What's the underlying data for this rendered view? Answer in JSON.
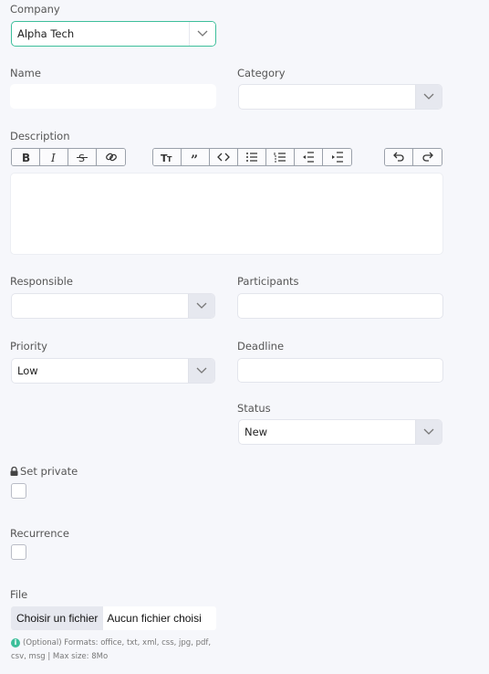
{
  "company": {
    "label": "Company",
    "value": "Alpha Tech"
  },
  "name": {
    "label": "Name",
    "value": ""
  },
  "category": {
    "label": "Category",
    "value": ""
  },
  "description": {
    "label": "Description",
    "value": ""
  },
  "toolbar": {
    "group1": [
      "bold-icon",
      "italic-icon",
      "strikethrough-icon",
      "link-icon"
    ],
    "group2": [
      "text-size-icon",
      "quote-icon",
      "code-icon",
      "bullet-list-icon",
      "numbered-list-icon",
      "outdent-icon",
      "indent-icon"
    ],
    "group3": [
      "undo-icon",
      "redo-icon"
    ]
  },
  "responsible": {
    "label": "Responsible",
    "value": ""
  },
  "participants": {
    "label": "Participants",
    "value": ""
  },
  "priority": {
    "label": "Priority",
    "value": "Low"
  },
  "deadline": {
    "label": "Deadline",
    "value": ""
  },
  "status": {
    "label": "Status",
    "value": "New"
  },
  "set_private": {
    "label": "Set private",
    "checked": false
  },
  "recurrence": {
    "label": "Recurrence",
    "checked": false
  },
  "file": {
    "label": "File",
    "button_label": "Choisir un fichier",
    "no_file_label": "Aucun fichier choisi",
    "help_line1": "(Optional) Formats: office, txt, xml, css, jpg, pdf,",
    "help_line2": "csv, msg | Max size: 8Mo"
  },
  "colors": {
    "accent": "#3dbf9b",
    "background": "#f6f7fb",
    "arrow_bg": "#e6e8ef"
  }
}
